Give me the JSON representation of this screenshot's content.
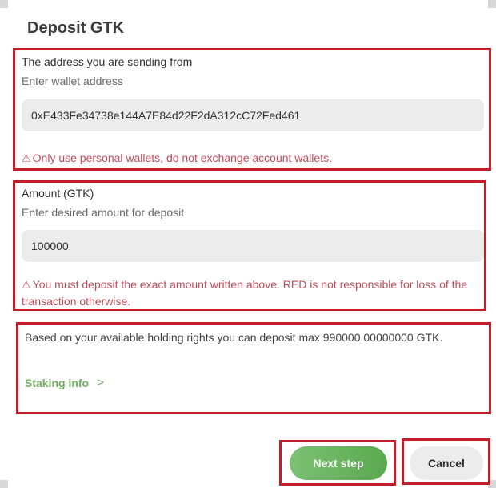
{
  "dialog": {
    "title": "Deposit GTK"
  },
  "address_section": {
    "label": "The address you are sending from",
    "sublabel": "Enter wallet address",
    "value": "0xE433Fe34738e144A7E84d22F2dA312cC72Fed461",
    "warning": "Only use personal wallets, do not exchange account wallets.",
    "warning_icon": "warning-triangle-icon"
  },
  "amount_section": {
    "label": "Amount (GTK)",
    "sublabel": "Enter desired amount for deposit",
    "value": "100000",
    "warning": "You must deposit the exact amount written above. RED is not responsible for loss of the transaction otherwise.",
    "warning_icon": "warning-triangle-icon"
  },
  "info_section": {
    "text": "Based on your available holding rights you can deposit max 990000.00000000 GTK.",
    "link_label": "Staking info",
    "link_icon": "chevron-right-icon"
  },
  "actions": {
    "next_label": "Next step",
    "cancel_label": "Cancel"
  },
  "colors": {
    "highlight_border": "#c21f2a",
    "warning_text": "#c24b5a",
    "accent_green": "#6fb05f",
    "field_bg": "#ececec"
  }
}
